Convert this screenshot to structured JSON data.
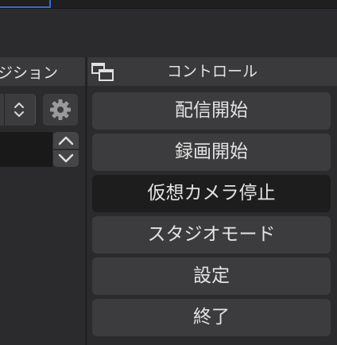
{
  "transitions_dock": {
    "title": "ジション"
  },
  "controls_dock": {
    "title": "コントロール",
    "buttons": {
      "start_streaming": "配信開始",
      "start_recording": "録画開始",
      "stop_virtual_camera": "仮想カメラ停止",
      "studio_mode": "スタジオモード",
      "settings": "設定",
      "exit": "終了"
    }
  },
  "icons": {
    "float": "undock-float-icon",
    "gear": "gear-icon",
    "updown": "select-updown-icon",
    "spin_up": "chevron-up-icon",
    "spin_down": "chevron-down-icon"
  },
  "colors": {
    "background": "#2b2b2d",
    "button": "#3c3c3e",
    "button_active": "#1d1d1e",
    "header": "#3a3a3c",
    "accent": "#2f6fd4",
    "text": "#e3e3e3"
  }
}
